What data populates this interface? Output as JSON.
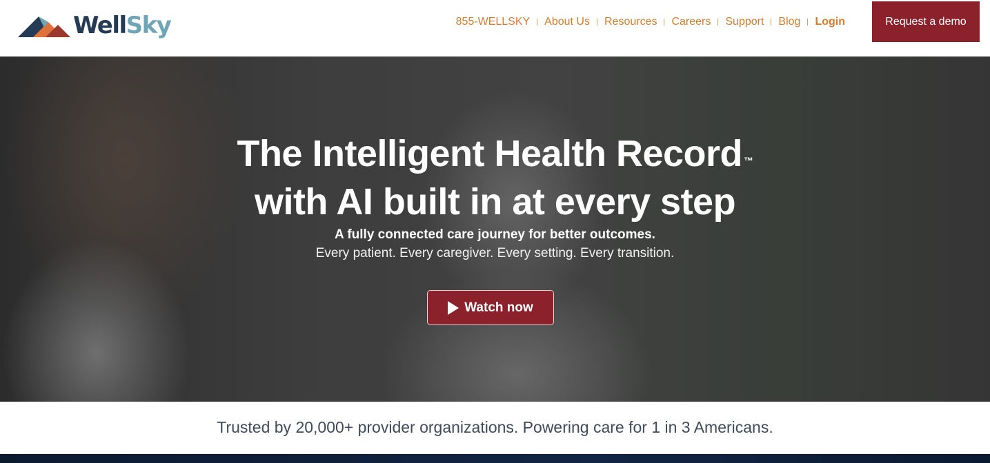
{
  "brand": {
    "name_part1": "Well",
    "name_part2": "Sky",
    "colors": {
      "navy": "#253a54",
      "teal": "#6fa6b6",
      "orange": "#d57d2e",
      "red": "#8b222b"
    }
  },
  "nav": {
    "items": [
      {
        "label": "855-WELLSKY"
      },
      {
        "label": "About Us"
      },
      {
        "label": "Resources"
      },
      {
        "label": "Careers"
      },
      {
        "label": "Support"
      },
      {
        "label": "Blog"
      },
      {
        "label": "Login"
      }
    ],
    "demo_button": "Request a demo"
  },
  "hero": {
    "title_line1": "The Intelligent Health Record",
    "trademark": "™",
    "title_line2": "with AI built in at every step",
    "subtitle": "A fully connected care journey for better outcomes.",
    "tagline": "Every patient. Every caregiver. Every setting. Every transition.",
    "watch_button": "Watch now",
    "watch_icon": "play-icon"
  },
  "trust": {
    "text": "Trusted by 20,000+ provider organizations. Powering care for 1 in 3 Americans."
  }
}
